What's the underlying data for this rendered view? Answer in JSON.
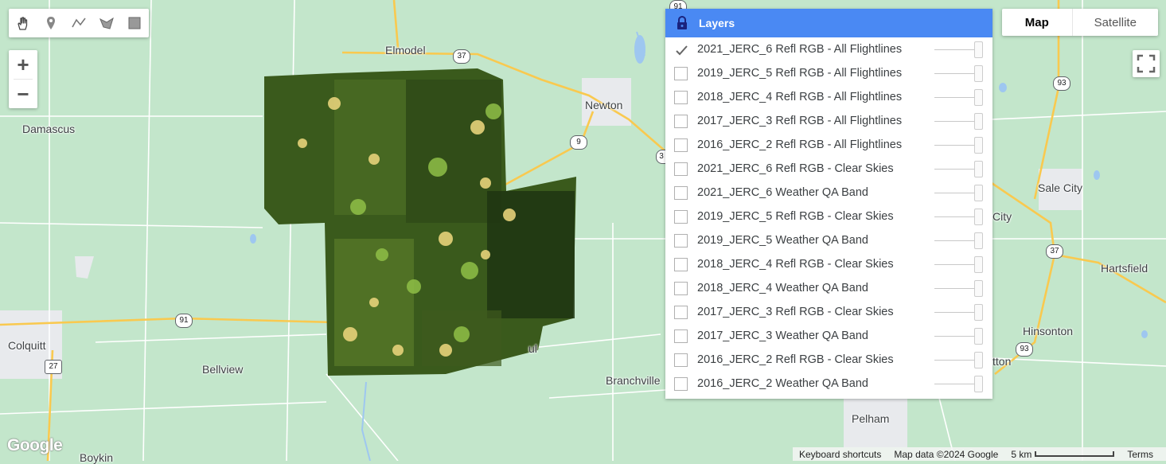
{
  "toolbar": {
    "tools": [
      {
        "icon": "hand-icon"
      },
      {
        "icon": "marker-icon"
      },
      {
        "icon": "polyline-icon"
      },
      {
        "icon": "polygon-icon"
      },
      {
        "icon": "rectangle-icon"
      }
    ]
  },
  "zoom": {
    "in_label": "+",
    "out_label": "−"
  },
  "map_type": {
    "map_label": "Map",
    "satellite_label": "Satellite",
    "selected": "Map"
  },
  "layers_panel": {
    "title": "Layers",
    "header_color": "#4a89f3",
    "layers": [
      {
        "label": "2021_JERC_6 Refl RGB - All Flightlines",
        "checked": true
      },
      {
        "label": "2019_JERC_5 Refl RGB - All Flightlines",
        "checked": false
      },
      {
        "label": "2018_JERC_4 Refl RGB - All Flightlines",
        "checked": false
      },
      {
        "label": "2017_JERC_3 Refl RGB - All Flightlines",
        "checked": false
      },
      {
        "label": "2016_JERC_2 Refl RGB - All Flightlines",
        "checked": false
      },
      {
        "label": "2021_JERC_6 Refl RGB - Clear Skies",
        "checked": false
      },
      {
        "label": "2021_JERC_6 Weather QA Band",
        "checked": false
      },
      {
        "label": "2019_JERC_5 Refl RGB - Clear Skies",
        "checked": false
      },
      {
        "label": "2019_JERC_5 Weather QA Band",
        "checked": false
      },
      {
        "label": "2018_JERC_4 Refl RGB - Clear Skies",
        "checked": false
      },
      {
        "label": "2018_JERC_4 Weather QA Band",
        "checked": false
      },
      {
        "label": "2017_JERC_3 Refl RGB - Clear Skies",
        "checked": false
      },
      {
        "label": "2017_JERC_3 Weather QA Band",
        "checked": false
      },
      {
        "label": "2016_JERC_2 Refl RGB - Clear Skies",
        "checked": false
      },
      {
        "label": "2016_JERC_2 Weather QA Band",
        "checked": false
      }
    ]
  },
  "map": {
    "places": [
      {
        "name": "Elmodel"
      },
      {
        "name": "Newton"
      },
      {
        "name": "Damascus"
      },
      {
        "name": "Sale City"
      },
      {
        "name": "City"
      },
      {
        "name": "Hartsfield"
      },
      {
        "name": "Hinsonton"
      },
      {
        "name": "tton"
      },
      {
        "name": "Colquitt"
      },
      {
        "name": "Bellview"
      },
      {
        "name": "Branchville"
      },
      {
        "name": "Pelham"
      },
      {
        "name": "Boykin"
      },
      {
        "name": "ul"
      }
    ],
    "shields": [
      {
        "label": "37"
      },
      {
        "label": "91"
      },
      {
        "label": "9"
      },
      {
        "label": "3"
      },
      {
        "label": "93"
      },
      {
        "label": "37"
      },
      {
        "label": "93"
      },
      {
        "label": "91"
      },
      {
        "label": "27"
      }
    ]
  },
  "footer": {
    "logo": "Google",
    "keyboard_shortcuts": "Keyboard shortcuts",
    "map_data": "Map data ©2024 Google",
    "scale": "5 km",
    "terms": "Terms"
  }
}
